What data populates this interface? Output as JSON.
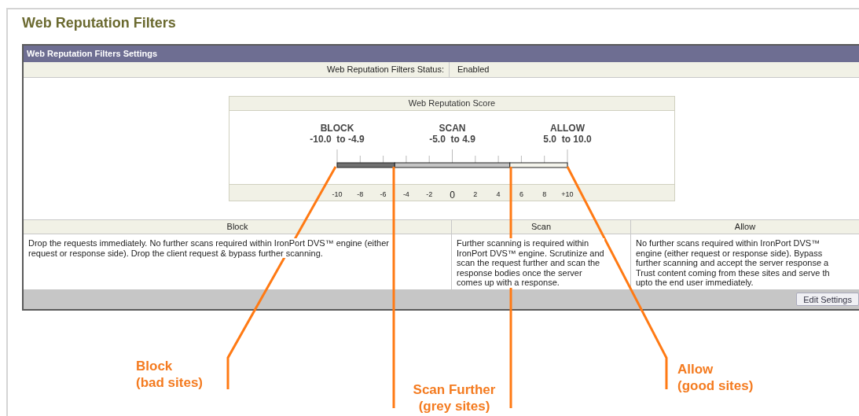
{
  "page": {
    "title": "Web Reputation Filters"
  },
  "panel": {
    "title": "Web Reputation Filters Settings",
    "status_label": "Web Reputation Filters Status:",
    "status_value": "Enabled"
  },
  "score": {
    "title": "Web Reputation Score",
    "ranges": [
      {
        "name": "BLOCK",
        "range": "-10.0  to -4.9",
        "color": "#707070"
      },
      {
        "name": "SCAN",
        "range": "-5.0  to 4.9",
        "color": "#c4c4c4"
      },
      {
        "name": "ALLOW",
        "range": "5.0  to 10.0",
        "color": "#f4f4ec"
      }
    ],
    "ticks": [
      "-10",
      "-8",
      "-6",
      "-4",
      "-2",
      "0",
      "2",
      "4",
      "6",
      "8",
      "+10"
    ]
  },
  "columns": [
    {
      "header": "Block",
      "lines": [
        "Drop the requests immediately. No further scans required within IronPort DVS™ engine (either",
        "request or response side). Drop the client request & bypass further scanning."
      ]
    },
    {
      "header": "Scan",
      "lines": [
        "Further scanning is required within",
        "IronPort DVS™ engine. Scrutinize and",
        "scan the request further and scan the",
        "response bodies once the server",
        "comes up with a response."
      ]
    },
    {
      "header": "Allow",
      "lines": [
        "No further scans required within IronPort DVS™",
        "engine (either request or response side). Bypass",
        "further scanning and accept the server response a",
        "Trust content coming from these sites and serve th",
        "upto the end user immediately."
      ]
    }
  ],
  "edit_button": "Edit Settings",
  "annotations": [
    {
      "lines": [
        "Block",
        "(bad sites)"
      ]
    },
    {
      "lines": [
        "Scan Further",
        "(grey sites)"
      ]
    },
    {
      "lines": [
        "Allow",
        "(good sites)"
      ]
    }
  ]
}
